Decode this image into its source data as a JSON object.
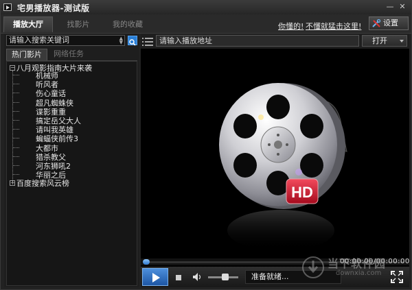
{
  "window": {
    "title": "宅男播放器-测试版",
    "min_glyph": "—",
    "close_glyph": "✕"
  },
  "tabs": [
    {
      "label": "播放大厅",
      "active": true
    },
    {
      "label": "找影片",
      "active": false
    },
    {
      "label": "我的收藏",
      "active": false
    }
  ],
  "header_links": {
    "link1": "你懂的!",
    "link2": "不懂就猛击这里!"
  },
  "settings": {
    "label": "设置",
    "icon": "wrench-screwdriver-icon"
  },
  "search": {
    "placeholder": "请输入搜索关键词",
    "icon": "search-icon"
  },
  "subtabs": [
    {
      "label": "热门影片",
      "active": true
    },
    {
      "label": "网络任务",
      "active": false
    }
  ],
  "tree": {
    "groups": [
      {
        "label": "八月观影指南大片来袭",
        "expanded": true,
        "expander": "−",
        "items": [
          "机械师",
          "听风者",
          "伤心童话",
          "超凡蜘蛛侠",
          "谍影重重",
          "搞定岳父大人",
          "请叫我英雄",
          "蝙蝠侠前传3",
          "大都市",
          "猎杀教父",
          "河东狮吼2",
          "华丽之后"
        ]
      },
      {
        "label": "百度搜索风云榜",
        "expanded": false,
        "expander": "+",
        "items": []
      }
    ]
  },
  "address": {
    "placeholder": "请输入播放地址",
    "open_label": "打开"
  },
  "video": {
    "badge": "HD",
    "logo": "film-reel-icon"
  },
  "playback": {
    "time": "00:00:00/00:00:00",
    "status": "准备就绪..."
  },
  "watermark": {
    "text": "当下软件园",
    "url": "downxia.com"
  },
  "colors": {
    "accent": "#2a7fd6",
    "background": "#222222",
    "hd_badge": "#c8102e"
  }
}
